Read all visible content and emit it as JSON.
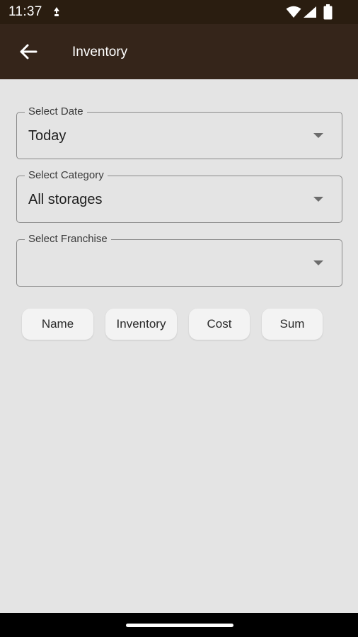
{
  "status_bar": {
    "time": "11:37",
    "icons": [
      "notification-icon",
      "wifi-icon",
      "signal-icon",
      "battery-icon"
    ]
  },
  "app_bar": {
    "title": "Inventory",
    "back_icon": "arrow-left-icon"
  },
  "filters": {
    "date": {
      "label": "Select Date",
      "value": "Today"
    },
    "category": {
      "label": "Select Category",
      "value": "All storages"
    },
    "franchise": {
      "label": "Select Franchise",
      "value": ""
    }
  },
  "sort_chips": [
    "Name",
    "Inventory",
    "Cost",
    "Sum"
  ],
  "colors": {
    "status_bar": "#2a1d10",
    "app_bar": "#35251a",
    "background": "#e4e4e4",
    "chip": "#f3f3f3"
  }
}
